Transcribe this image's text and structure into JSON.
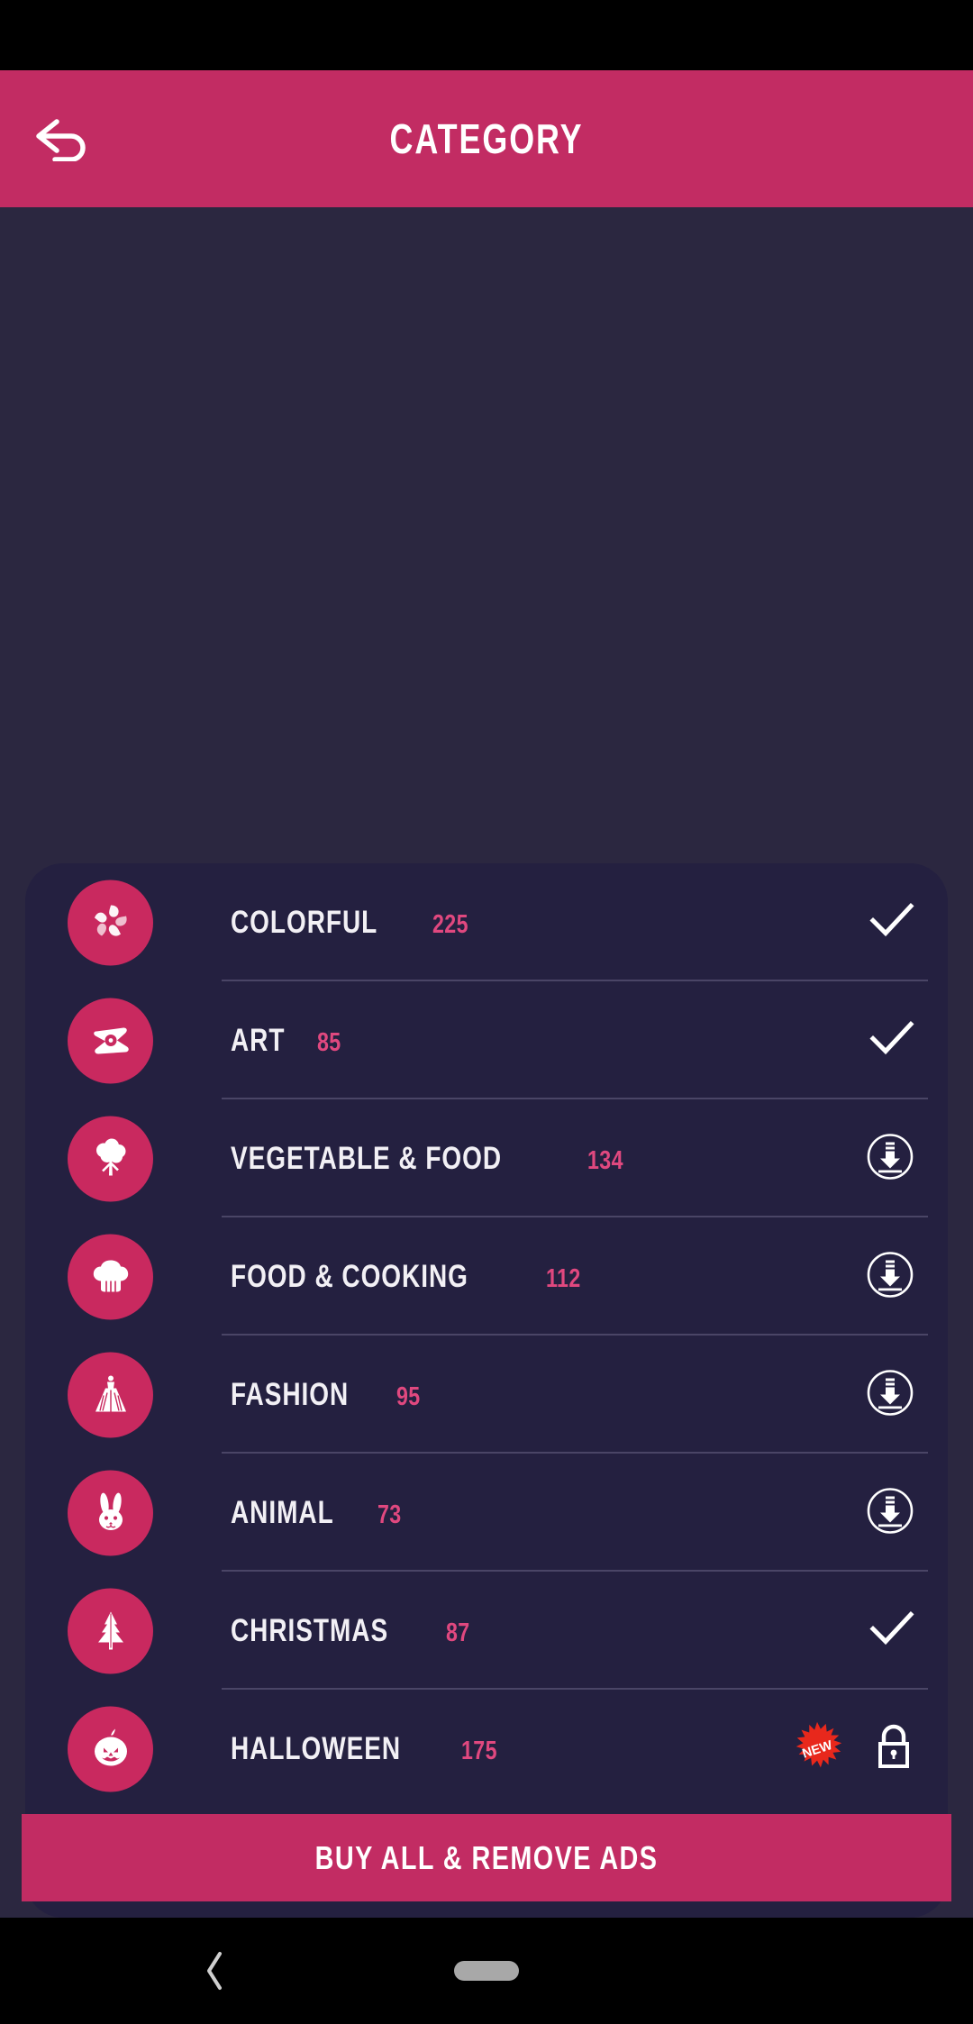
{
  "app_bar": {
    "title": "CATEGORY",
    "back_icon": "back-arrow-icon"
  },
  "categories": [
    {
      "name": "COLORFUL",
      "count": "225",
      "icon": "pinwheel-icon",
      "state": "owned",
      "badge": null
    },
    {
      "name": "ART",
      "count": "85",
      "icon": "palette-icon",
      "state": "owned",
      "badge": null
    },
    {
      "name": "VEGETABLE & FOOD",
      "count": "134",
      "icon": "broccoli-icon",
      "state": "download",
      "badge": null
    },
    {
      "name": "FOOD & COOKING",
      "count": "112",
      "icon": "chef-hat-icon",
      "state": "download",
      "badge": null
    },
    {
      "name": "FASHION",
      "count": "95",
      "icon": "dress-icon",
      "state": "download",
      "badge": null
    },
    {
      "name": "ANIMAL",
      "count": "73",
      "icon": "rabbit-icon",
      "state": "download",
      "badge": null
    },
    {
      "name": "CHRISTMAS",
      "count": "87",
      "icon": "pine-tree-icon",
      "state": "owned",
      "badge": null
    },
    {
      "name": "HALLOWEEN",
      "count": "175",
      "icon": "pumpkin-icon",
      "state": "locked",
      "badge": "NEW"
    }
  ],
  "buy_bar": {
    "label": "BUY ALL & REMOVE ADS"
  },
  "nav_bar": {
    "back_icon": "chevron-left-icon",
    "home_icon": "home-pill-icon"
  },
  "colors": {
    "accent_pink": "#c22c63",
    "icon_pink": "#c9295f",
    "count_pink": "#e0487f",
    "page_bg": "#2b2740",
    "card_bg": "#242040",
    "divider": "#4a4566",
    "badge_red": "#e8281c",
    "white": "#ffffff"
  }
}
